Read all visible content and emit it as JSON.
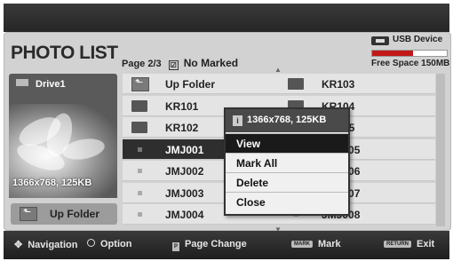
{
  "header": {
    "title": "PHOTO LIST",
    "page": "Page 2/3",
    "mark_status": "No Marked"
  },
  "usb": {
    "label": "USB Device",
    "free_space": "Free Space 150MB",
    "used_fraction": 0.55,
    "bar_color": "#c21818"
  },
  "left": {
    "drive": "Drive1",
    "resolution": "1366x768, 125KB",
    "up_button": "Up Folder"
  },
  "list": {
    "col1": [
      {
        "label": "Up Folder",
        "type": "up"
      },
      {
        "label": "KR101",
        "type": "folder"
      },
      {
        "label": "KR102",
        "type": "folder"
      },
      {
        "label": "JMJ001",
        "type": "file",
        "selected": true
      },
      {
        "label": "JMJ002",
        "type": "file"
      },
      {
        "label": "JMJ003",
        "type": "file"
      },
      {
        "label": "JMJ004",
        "type": "file"
      }
    ],
    "col2": [
      {
        "label": "KR103",
        "type": "folder"
      },
      {
        "label": "KR104",
        "type": "folder"
      },
      {
        "label": "KR105",
        "type": "folder"
      },
      {
        "label": "JMJ005",
        "type": "file"
      },
      {
        "label": "JMJ006",
        "type": "file"
      },
      {
        "label": "JMJ007",
        "type": "file"
      },
      {
        "label": "JMJ008",
        "type": "file"
      }
    ]
  },
  "popup": {
    "info": "1366x768, 125KB",
    "items": [
      "View",
      "Mark All",
      "Delete",
      "Close"
    ],
    "selected_index": 0
  },
  "footer": {
    "navigation": "Navigation",
    "option": "Option",
    "page_change": "Page Change",
    "mark_key": "MARK",
    "mark": "Mark",
    "return_key": "RETURN",
    "exit": "Exit"
  }
}
